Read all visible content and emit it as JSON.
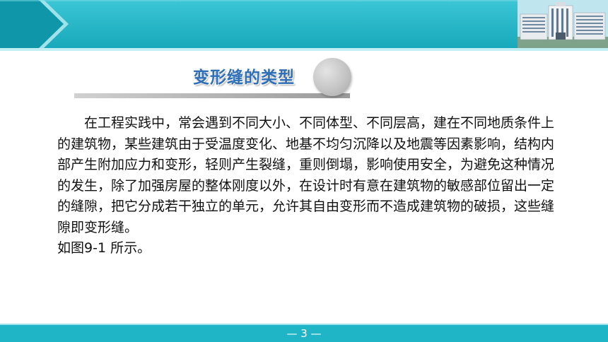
{
  "title": "变形缝的类型",
  "body": {
    "paragraph": "在工程实践中，常会遇到不同大小、不同体型、不同层高，建在不同地质条件上的建筑物，某些建筑由于受温度变化、地基不均匀沉降以及地震等因素影响，结构内部产生附加应力和变形，轻则产生裂缝，重则倒塌，影响使用安全，为避免这种情况的发生，除了加强房屋的整体刚度以外，在设计时有意在建筑物的敏感部位留出一定的缝隙，把它分成若干独立的单元，允许其自由变形而不造成建筑物的破损，这些缝隙即变形缝。",
    "figure_ref": "如图9-1 所示。"
  },
  "footer": {
    "page_number": "— 3 —"
  },
  "colors": {
    "accent": "#1fb5c7",
    "title": "#2f6fb8"
  },
  "icons": {
    "header_image": "building-image"
  }
}
